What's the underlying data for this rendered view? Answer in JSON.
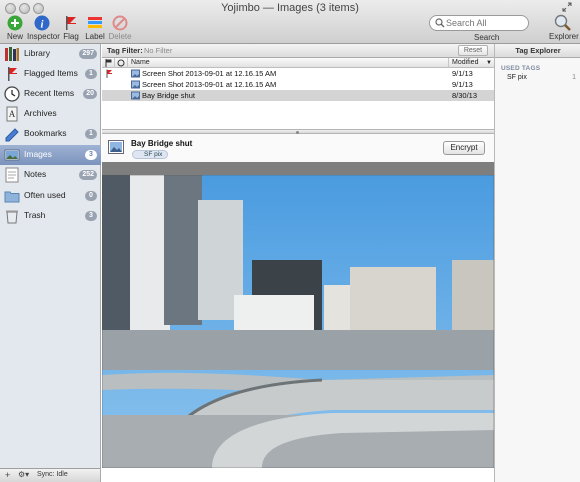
{
  "window": {
    "title": "Yojimbo — Images (3 items)"
  },
  "toolbar": {
    "buttons": [
      {
        "label": "New",
        "icon": "plus-circle-icon"
      },
      {
        "label": "Inspector",
        "icon": "info-icon"
      },
      {
        "label": "Flag",
        "icon": "flag-icon"
      },
      {
        "label": "Label",
        "icon": "label-icon"
      },
      {
        "label": "Delete",
        "icon": "delete-icon"
      }
    ],
    "search_placeholder": "Search All",
    "search_caption": "Search",
    "explorer_label": "Explorer"
  },
  "sidebar": {
    "items": [
      {
        "label": "Library",
        "count": "297",
        "icon": "library-icon"
      },
      {
        "label": "Flagged Items",
        "count": "1",
        "icon": "flag-icon"
      },
      {
        "label": "Recent Items",
        "count": "20",
        "icon": "clock-icon"
      },
      {
        "label": "Archives",
        "count": "",
        "icon": "archive-icon"
      },
      {
        "label": "Bookmarks",
        "count": "1",
        "icon": "bookmark-icon"
      },
      {
        "label": "Images",
        "count": "3",
        "icon": "images-icon"
      },
      {
        "label": "Notes",
        "count": "252",
        "icon": "notes-icon"
      },
      {
        "label": "Often used",
        "count": "0",
        "icon": "folder-icon"
      },
      {
        "label": "Trash",
        "count": "3",
        "icon": "trash-icon"
      }
    ],
    "bottom": {
      "add": "+",
      "gear": "⚙▾",
      "sync": "Sync: Idle"
    }
  },
  "tag_filter": {
    "label": "Tag Filter:",
    "value": "No Filter",
    "reset": "Reset"
  },
  "list": {
    "columns": {
      "name": "Name",
      "modified": "Modified"
    },
    "rows": [
      {
        "name": "Screen Shot 2013-09-01 at 12.16.15 AM",
        "modified": "9/1/13",
        "flagged": true
      },
      {
        "name": "Screen Shot 2013-09-01 at 12.16.15 AM",
        "modified": "9/1/13",
        "flagged": false
      },
      {
        "name": "Bay Bridge shut",
        "modified": "8/30/13",
        "flagged": false
      }
    ]
  },
  "detail": {
    "title": "Bay Bridge shut",
    "tag": "SF pix",
    "encrypt_label": "Encrypt"
  },
  "tag_explorer": {
    "title": "Tag Explorer",
    "section": "USED TAGS",
    "tags": [
      {
        "name": "SF pix",
        "count": "1"
      }
    ]
  },
  "colors": {
    "selection": "#7b93bd",
    "sidebar_bg": "#e3e8ee"
  }
}
